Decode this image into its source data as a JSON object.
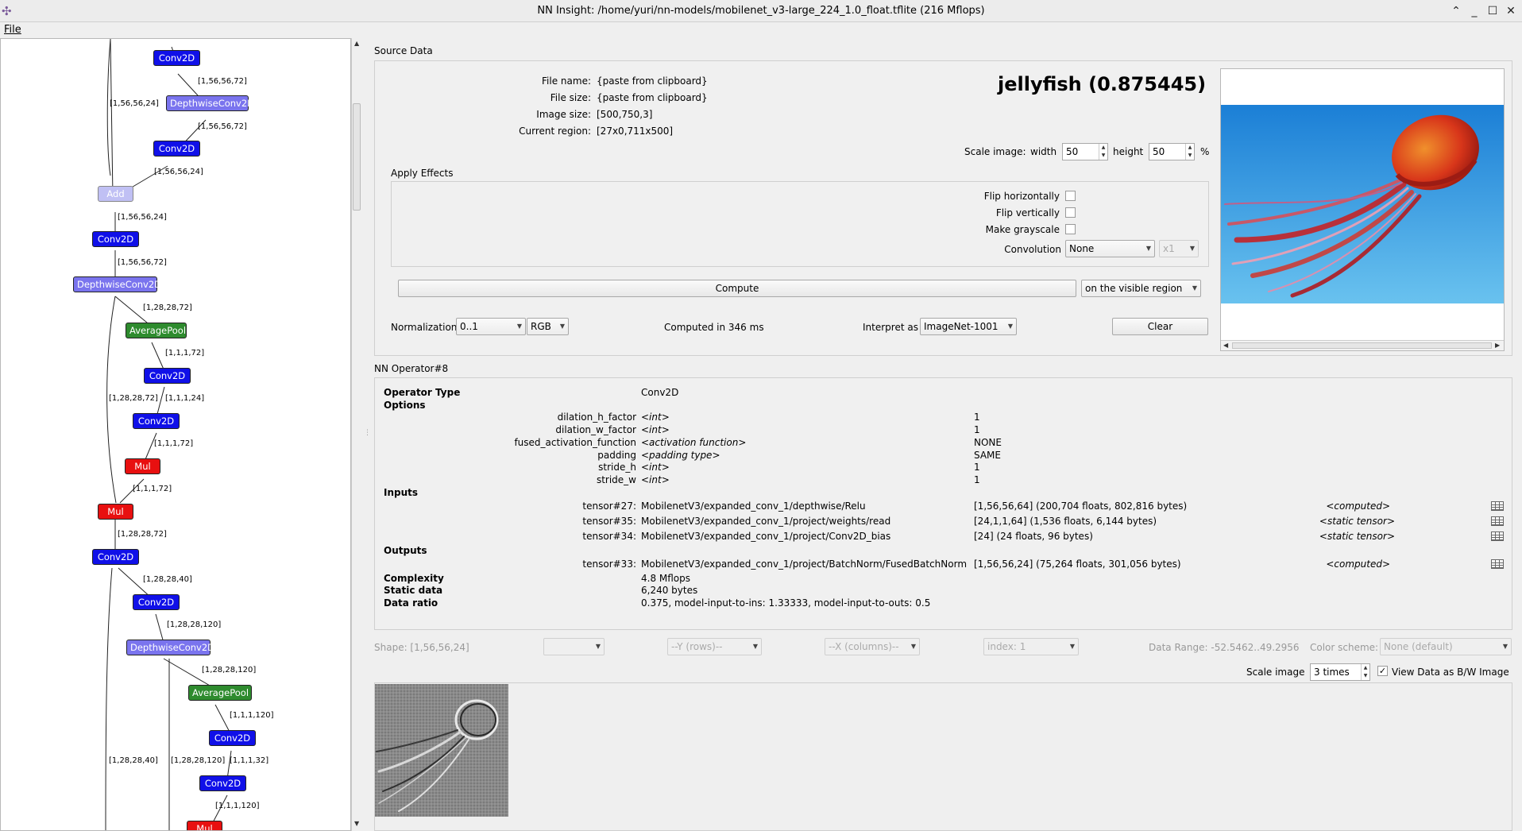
{
  "window": {
    "title": "NN Insight: /home/yuri/nn-models/mobilenet_v3-large_224_1.0_float.tflite (216 Mflops)"
  },
  "menu": {
    "file": "File"
  },
  "graph": {
    "nodes": [
      "Conv2D",
      "DepthwiseConv2D",
      "Conv2D",
      "Add",
      "Conv2D",
      "DepthwiseConv2D",
      "AveragePool",
      "Conv2D",
      "Conv2D",
      "Mul",
      "Mul",
      "Conv2D",
      "Conv2D",
      "DepthwiseConv2D",
      "AveragePool",
      "Conv2D",
      "Conv2D",
      "Mul"
    ],
    "edges": [
      "[1,56,56,72]",
      "[1,56,56,24]",
      "[1,56,56,72]",
      "[1,56,56,24]",
      "[1,56,56,24]",
      "[1,56,56,72]",
      "[1,28,28,72]",
      "[1,1,1,72]",
      "[1,28,28,72]",
      "[1,1,1,24]",
      "[1,1,1,72]",
      "[1,1,1,72]",
      "[1,28,28,72]",
      "[1,28,28,40]",
      "[1,28,28,120]",
      "[1,28,28,120]",
      "[1,1,1,120]",
      "[1,28,28,40]",
      "[1,28,28,120]",
      "[1,1,1,32]",
      "[1,1,1,120]"
    ]
  },
  "source": {
    "section_title": "Source Data",
    "file_name_label": "File name:",
    "file_name": "{paste from clipboard}",
    "file_size_label": "File size:",
    "file_size": "{paste from clipboard}",
    "image_size_label": "Image size:",
    "image_size": "[500,750,3]",
    "region_label": "Current region:",
    "region": "[27x0,711x500]",
    "result": "jellyfish (0.875445)",
    "scale_label": "Scale image:",
    "width_label": "width",
    "width": "50",
    "height_label": "height",
    "height": "50",
    "pct": "%",
    "effects_title": "Apply Effects",
    "flip_h": "Flip horizontally",
    "flip_v": "Flip vertically",
    "grayscale": "Make grayscale",
    "convolution_label": "Convolution",
    "convolution": "None",
    "conv_mult": "x1",
    "compute": "Compute",
    "compute_region": "on the visible region",
    "normalization_label": "Normalization",
    "normalization": "0..1",
    "color_order": "RGB",
    "computed_in": "Computed in 346 ms",
    "interpret_label": "Interpret as",
    "interpret": "ImageNet-1001",
    "clear": "Clear"
  },
  "operator": {
    "section_title": "NN Operator#8",
    "type_label": "Operator Type",
    "type": "Conv2D",
    "options_label": "Options",
    "options": [
      {
        "name": "dilation_h_factor",
        "type": "<int>",
        "value": "1"
      },
      {
        "name": "dilation_w_factor",
        "type": "<int>",
        "value": "1"
      },
      {
        "name": "fused_activation_function",
        "type": "<activation function>",
        "value": "NONE"
      },
      {
        "name": "padding",
        "type": "<padding type>",
        "value": "SAME"
      },
      {
        "name": "stride_h",
        "type": "<int>",
        "value": "1"
      },
      {
        "name": "stride_w",
        "type": "<int>",
        "value": "1"
      }
    ],
    "inputs_label": "Inputs",
    "inputs": [
      {
        "id": "tensor#27:",
        "name": "MobilenetV3/expanded_conv_1/depthwise/Relu",
        "shape": "[1,56,56,64] (200,704 floats, 802,816 bytes)",
        "kind": "<computed>"
      },
      {
        "id": "tensor#35:",
        "name": "MobilenetV3/expanded_conv_1/project/weights/read",
        "shape": "[24,1,1,64] (1,536 floats, 6,144 bytes)",
        "kind": "<static tensor>"
      },
      {
        "id": "tensor#34:",
        "name": "MobilenetV3/expanded_conv_1/project/Conv2D_bias",
        "shape": "[24] (24 floats, 96 bytes)",
        "kind": "<static tensor>"
      }
    ],
    "outputs_label": "Outputs",
    "outputs": [
      {
        "id": "tensor#33:",
        "name": "MobilenetV3/expanded_conv_1/project/BatchNorm/FusedBatchNorm",
        "shape": "[1,56,56,24] (75,264 floats, 301,056 bytes)",
        "kind": "<computed>"
      }
    ],
    "complexity_label": "Complexity",
    "complexity": "4.8 Mflops",
    "static_label": "Static data",
    "static": "6,240 bytes",
    "ratio_label": "Data ratio",
    "ratio": "0.375, model-input-to-ins: 1.33333, model-input-to-outs: 0.5"
  },
  "tensorview": {
    "shape": "Shape: [1,56,56,24]",
    "y_rows": "--Y (rows)--",
    "x_cols": "--X (columns)--",
    "index": "index: 1",
    "range": "Data Range: -52.5462..49.2956",
    "scheme_label": "Color scheme:",
    "scheme": "None (default)",
    "scale_label": "Scale image",
    "scale": "3 times",
    "bw_label": "View Data as B/W Image"
  }
}
